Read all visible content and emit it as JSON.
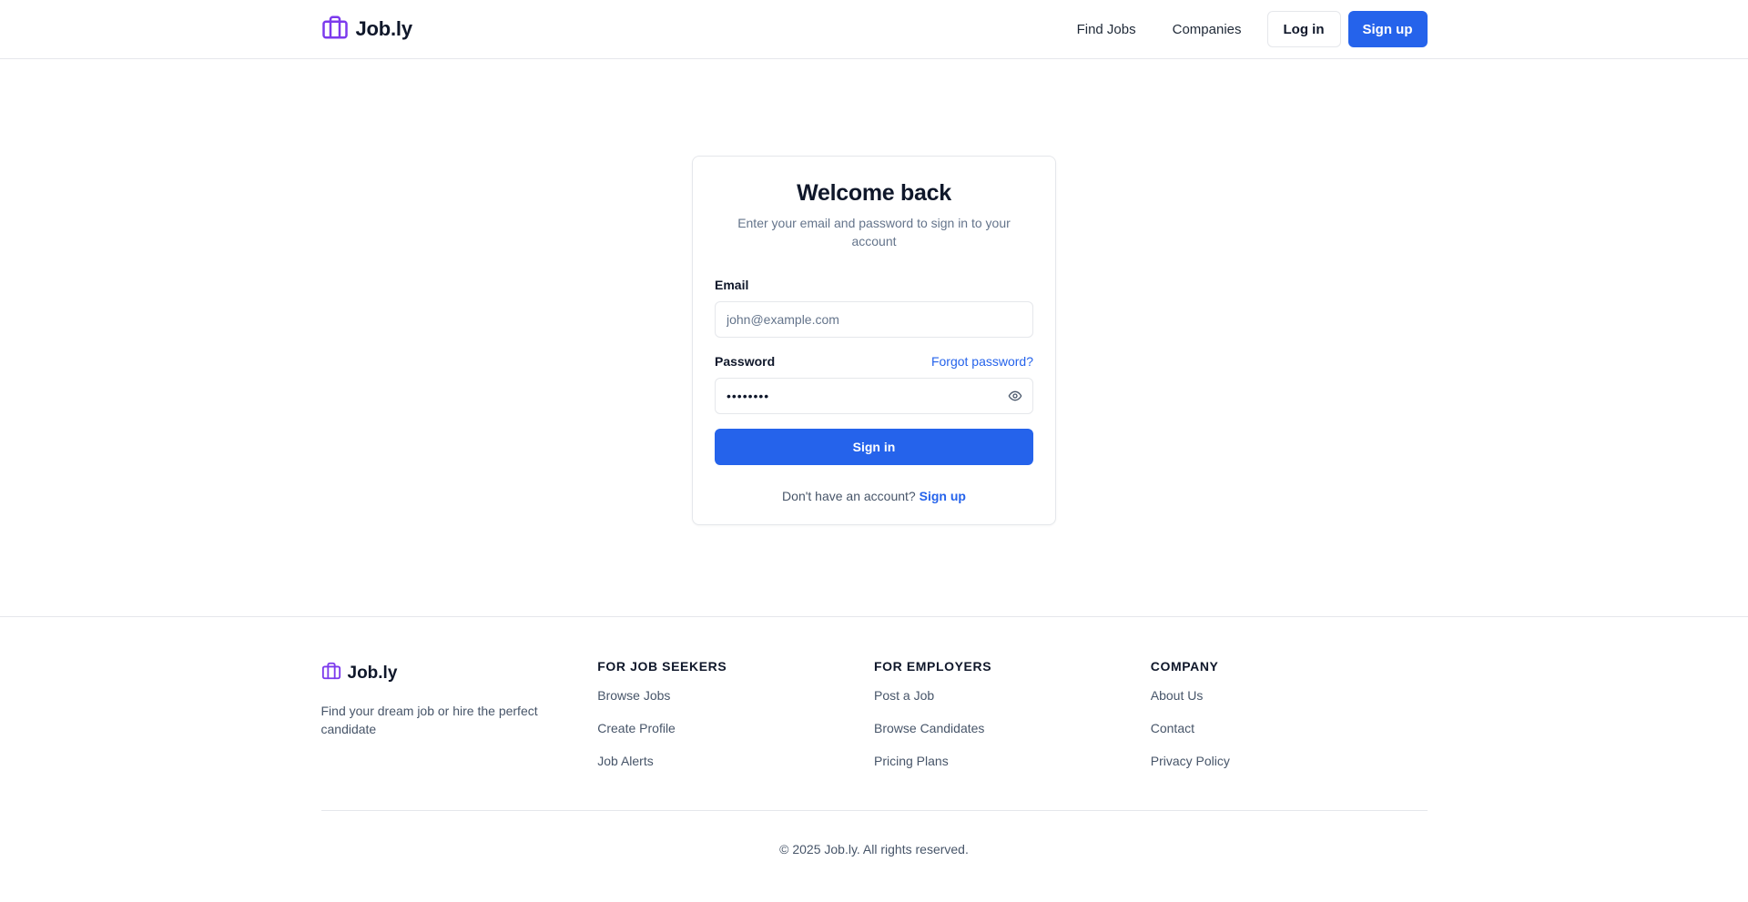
{
  "colors": {
    "primary": "#2563eb",
    "logo": "#7c3aed",
    "text": "#0f172a",
    "muted": "#64748b",
    "border": "#e5e7eb"
  },
  "header": {
    "brand": "Job.ly",
    "logo_icon": "briefcase-icon",
    "nav": {
      "find_jobs": "Find Jobs",
      "companies": "Companies",
      "login": "Log in",
      "signup": "Sign up"
    }
  },
  "login": {
    "title": "Welcome back",
    "subtitle": "Enter your email and password to sign in to your account",
    "email_label": "Email",
    "email_placeholder": "john@example.com",
    "password_label": "Password",
    "forgot_password": "Forgot password?",
    "password_value": "••••••••",
    "show_password_icon": "eye-icon",
    "submit": "Sign in",
    "no_account": "Don't have an account?",
    "signup_link": "Sign up"
  },
  "footer": {
    "brand": "Job.ly",
    "tagline": "Find your dream job or hire the perfect candidate",
    "columns": [
      {
        "title": "FOR JOB SEEKERS",
        "links": [
          "Browse Jobs",
          "Create Profile",
          "Job Alerts"
        ]
      },
      {
        "title": "FOR EMPLOYERS",
        "links": [
          "Post a Job",
          "Browse Candidates",
          "Pricing Plans"
        ]
      },
      {
        "title": "COMPANY",
        "links": [
          "About Us",
          "Contact",
          "Privacy Policy"
        ]
      }
    ],
    "copyright": "© 2025 Job.ly. All rights reserved."
  }
}
